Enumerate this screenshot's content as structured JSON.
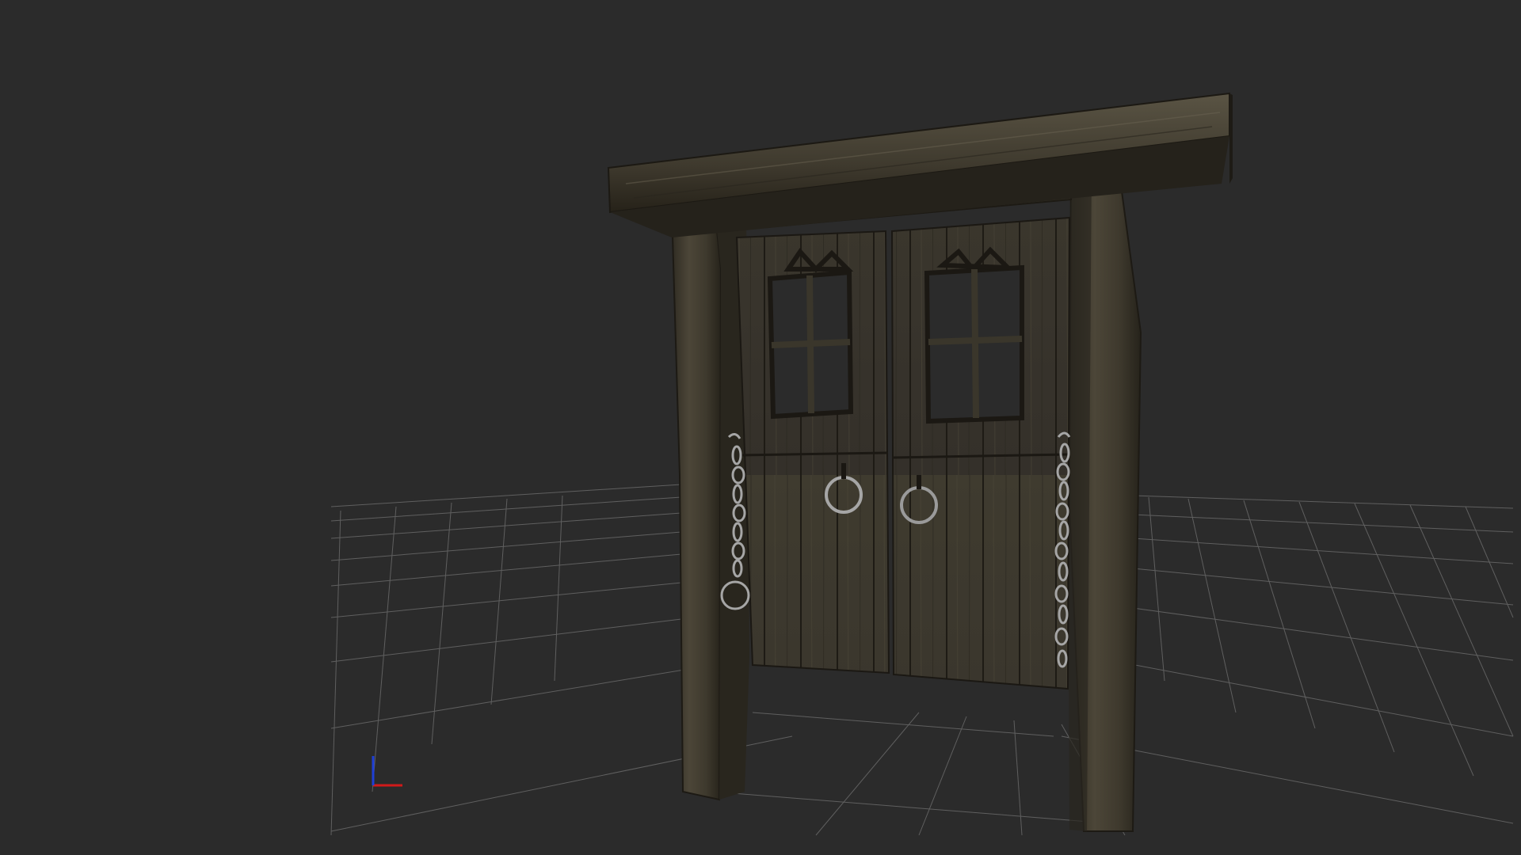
{
  "viewport": {
    "background_color": "#2b2b2b",
    "grid_line_color": "#8a8a8a",
    "wood_color": "#4a4436",
    "wood_dark_color": "#2e2a20",
    "metal_color": "#a6a6a6"
  },
  "axis_gizmo": {
    "x_axis_color": "#d11a1a",
    "y_axis_color": "#1f3fd6"
  },
  "model": {
    "name": "",
    "icon": "wooden-gate-model"
  }
}
